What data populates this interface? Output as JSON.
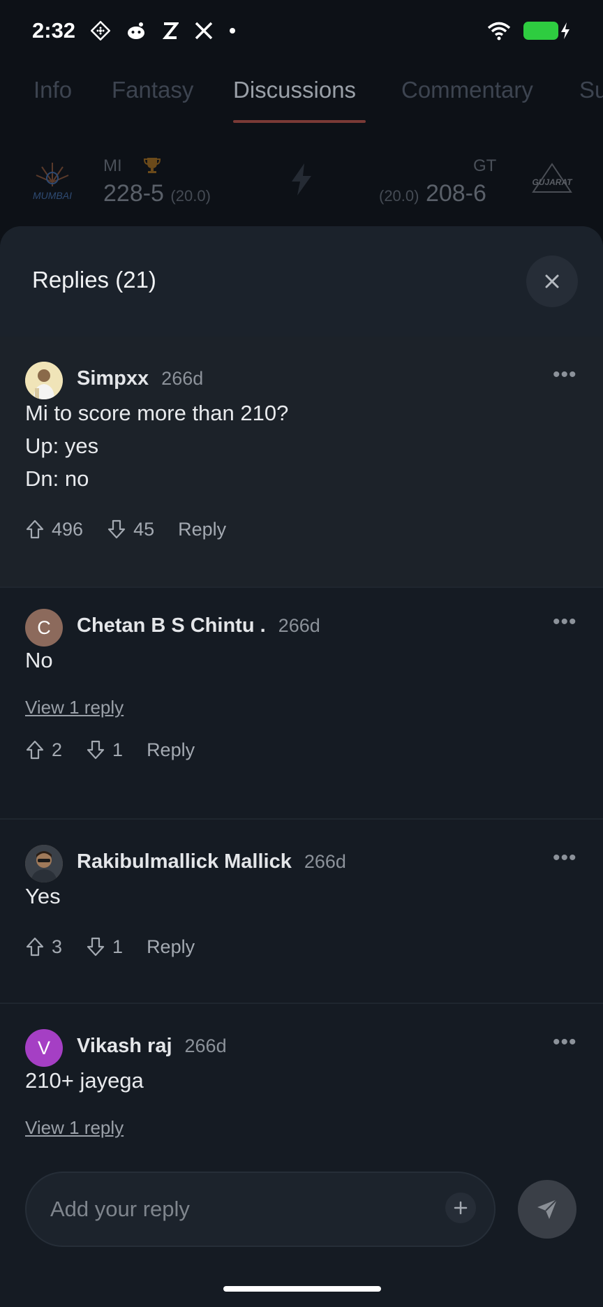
{
  "status_bar": {
    "time": "2:32",
    "left_icons": [
      "diamond-grid-icon",
      "reddit-icon",
      "z-icon",
      "x-icon",
      "dot-icon"
    ],
    "right_icons": [
      "wifi-icon",
      "battery-charging-icon"
    ],
    "battery_color": "#2ecc40"
  },
  "tabs": [
    {
      "label": "Info",
      "active": false
    },
    {
      "label": "Fantasy",
      "active": false
    },
    {
      "label": "Discussions",
      "active": true
    },
    {
      "label": "Commentary",
      "active": false
    },
    {
      "label": "Su",
      "active": false
    }
  ],
  "match": {
    "team1": {
      "logo_text": "MUMBAI",
      "short": "MI",
      "score": "228-5",
      "overs": "(20.0)",
      "winner": true
    },
    "team2": {
      "logo_text": "GUJARAT",
      "short": "GT",
      "score": "208-6",
      "overs": "(20.0)",
      "winner": false
    }
  },
  "sheet": {
    "title": "Replies (21)"
  },
  "comments": [
    {
      "author": "Simpxx",
      "age": "266d",
      "avatar_type": "photo",
      "avatar_color": "#e8d9a8",
      "lines": [
        "Mi to score more than 210?",
        "Up: yes",
        "Dn: no"
      ],
      "upvotes": "496",
      "downvotes": "45",
      "reply_label": "Reply",
      "highlighted": true
    },
    {
      "author": "Chetan B S Chintu .",
      "age": "266d",
      "avatar_type": "letter",
      "avatar_letter": "C",
      "avatar_color": "#8c6a5c",
      "lines": [
        "No"
      ],
      "view_replies": "View 1 reply",
      "upvotes": "2",
      "downvotes": "1",
      "reply_label": "Reply",
      "highlighted": false
    },
    {
      "author": "Rakibulmallick Mallick",
      "age": "266d",
      "avatar_type": "photo",
      "avatar_color": "#6b5a4a",
      "lines": [
        "Yes"
      ],
      "upvotes": "3",
      "downvotes": "1",
      "reply_label": "Reply",
      "highlighted": false
    },
    {
      "author": "Vikash raj",
      "age": "266d",
      "avatar_type": "letter",
      "avatar_letter": "V",
      "avatar_color": "#a53fc4",
      "lines": [
        "210+ jayega"
      ],
      "view_replies": "View 1 reply",
      "highlighted": false
    }
  ],
  "composer": {
    "placeholder": "Add your reply"
  }
}
